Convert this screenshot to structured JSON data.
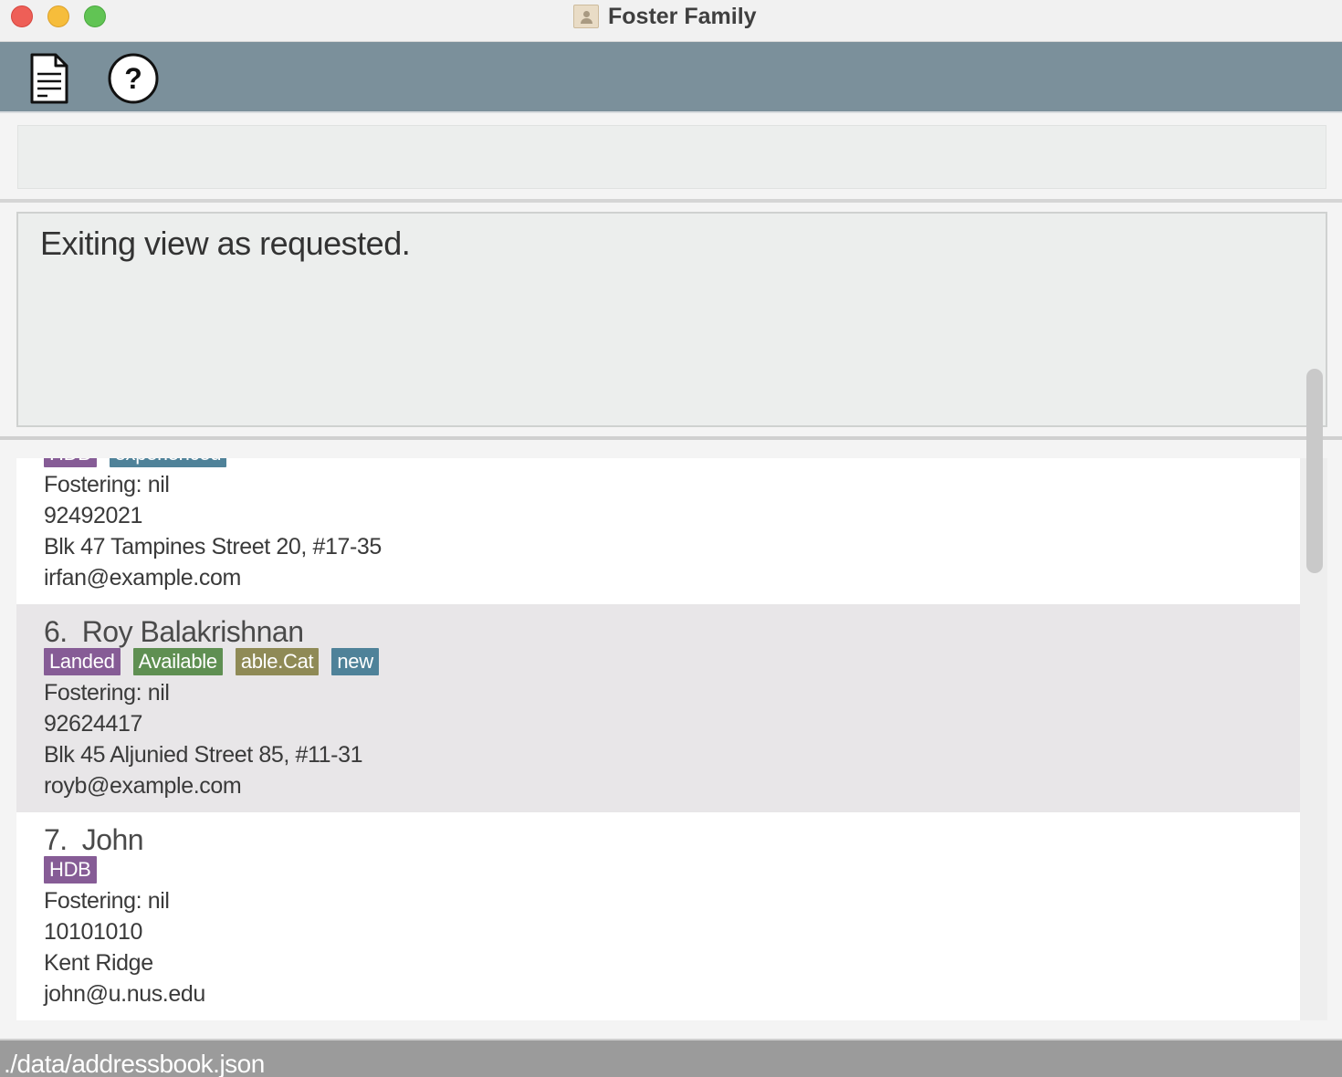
{
  "window": {
    "title": "Foster Family"
  },
  "toolbar": {
    "file_icon": "document-icon",
    "help_icon": "help-icon"
  },
  "command": {
    "value": "",
    "placeholder": ""
  },
  "result": {
    "message": "Exiting view as requested."
  },
  "persons": [
    {
      "tags": [
        {
          "label": "HDB",
          "color": "#865c96"
        },
        {
          "label": "experienced",
          "color": "#4f8299"
        }
      ],
      "fostering": "Fostering: nil",
      "phone": "92492021",
      "address": "Blk 47 Tampines Street 20, #17-35",
      "email": "irfan@example.com"
    },
    {
      "index": "6.",
      "name": "Roy Balakrishnan",
      "tags": [
        {
          "label": "Landed",
          "color": "#865c96"
        },
        {
          "label": "Available",
          "color": "#5f8f52"
        },
        {
          "label": "able.Cat",
          "color": "#8f8a56"
        },
        {
          "label": "new",
          "color": "#4f8299"
        }
      ],
      "fostering": "Fostering: nil",
      "phone": "92624417",
      "address": "Blk 45 Aljunied Street 85, #11-31",
      "email": "royb@example.com"
    },
    {
      "index": "7.",
      "name": "John",
      "tags": [
        {
          "label": "HDB",
          "color": "#865c96"
        }
      ],
      "fostering": "Fostering: nil",
      "phone": "10101010",
      "address": "Kent Ridge",
      "email": "john@u.nus.edu"
    }
  ],
  "status": {
    "file_path": "./data/addressbook.json"
  }
}
